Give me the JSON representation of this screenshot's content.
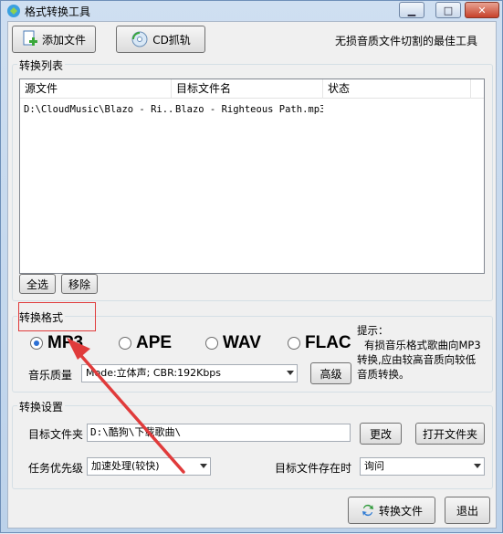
{
  "window": {
    "title": "格式转换工具"
  },
  "toolbar": {
    "add_file_label": "添加文件",
    "cd_rip_label": "CD抓轨",
    "slogan": "无损音质文件切割的最佳工具"
  },
  "convert_list": {
    "group_title": "转换列表",
    "columns": [
      "源文件",
      "目标文件名",
      "状态"
    ],
    "rows": [
      {
        "source": "D:\\CloudMusic\\Blazo - Ri..",
        "target": "Blazo - Righteous Path.mp3",
        "status": ""
      }
    ],
    "select_all_label": "全选",
    "remove_label": "移除"
  },
  "format": {
    "group_title": "转换格式",
    "options": [
      "MP3",
      "APE",
      "WAV",
      "FLAC"
    ],
    "selected": "MP3",
    "quality_label": "音乐质量",
    "quality_value": "Mode:立体声; CBR:192Kbps",
    "advanced_label": "高级",
    "tip_title": "提示：",
    "tip_lines": [
      "有损音乐格式歌曲向MP3",
      "转换,应由较高音质向较低",
      "音质转换。"
    ]
  },
  "settings": {
    "group_title": "转换设置",
    "target_folder_label": "目标文件夹",
    "target_folder_value": "D:\\酷狗\\下载歌曲\\",
    "change_label": "更改",
    "open_folder_label": "打开文件夹",
    "priority_label": "任务优先级",
    "priority_value": "加速处理(较快)",
    "exists_label": "目标文件存在时",
    "exists_value": "询问"
  },
  "footer": {
    "convert_label": "转换文件",
    "exit_label": "退出"
  },
  "colors": {
    "annotation_red": "#e03b3b",
    "radio_accent": "#2b6fd4",
    "titlebar_close": "#c7412a"
  }
}
